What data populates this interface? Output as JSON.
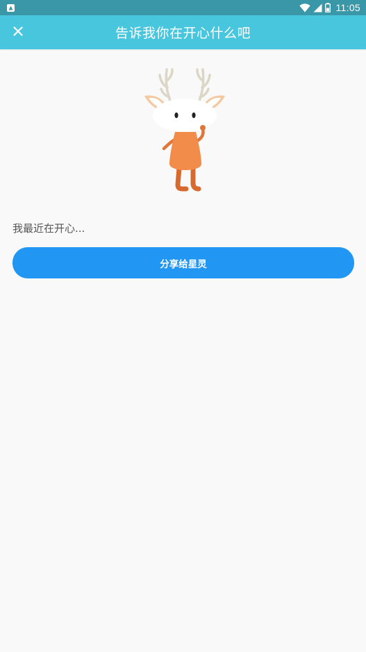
{
  "status_bar": {
    "time": "11:05",
    "icons": [
      "app-notification-icon",
      "wifi-icon",
      "cell-signal-icon",
      "battery-icon"
    ]
  },
  "app_bar": {
    "title": "告诉我你在开心什么吧",
    "close_icon": "close-icon"
  },
  "content": {
    "mascot_icon": "deer-mascot",
    "prompt": "我最近在开心...",
    "share_button_label": "分享给星灵"
  },
  "colors": {
    "status_bar": "#3a97a8",
    "app_bar": "#48c6dd",
    "background": "#f9f9f9",
    "button": "#2196f3",
    "mascot_body": "#f28c4a"
  }
}
